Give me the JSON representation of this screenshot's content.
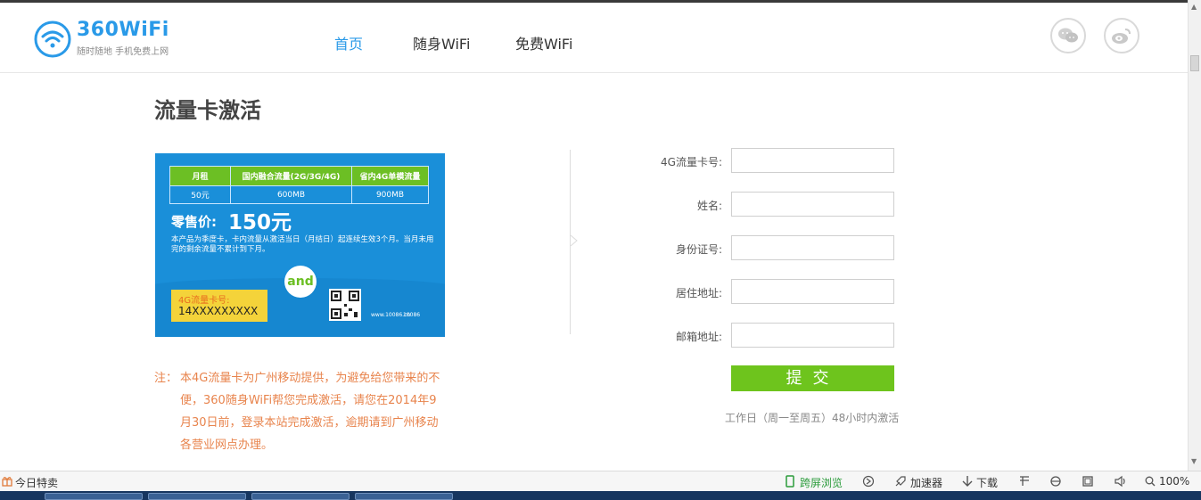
{
  "header": {
    "logo_title": "360WiFi",
    "logo_sub": "随时随地  手机免费上网",
    "nav": [
      {
        "label": "首页"
      },
      {
        "label": "随身WiFi"
      },
      {
        "label": "免费WiFi"
      }
    ]
  },
  "main": {
    "page_title": "流量卡激活",
    "card": {
      "table_headers": [
        "月租",
        "国内融合流量(2G/3G/4G)",
        "省内4G单模流量"
      ],
      "table_values": [
        "50元",
        "600MB",
        "900MB"
      ],
      "price_label": "零售价:",
      "price": "150元",
      "note": "本产品为季度卡，卡内流量从激活当日（月结日）起连续生效3个月。当月未用完的剩余流量不累计到下月。",
      "number_label": "4G流量卡号:",
      "number": "14XXXXXXXXX",
      "site1": "www.10086.cn",
      "site2": "10086"
    },
    "notice_head": "注：",
    "notice_body": "本4G流量卡为广州移动提供，为避免给您带来的不便，360随身WiFi帮您完成激活，请您在2014年9月30日前，登录本站完成激活，逾期请到广州移动各营业网点办理。"
  },
  "form": {
    "fields": [
      {
        "label": "4G流量卡号:",
        "value": ""
      },
      {
        "label": "姓名:",
        "value": ""
      },
      {
        "label": "身份证号:",
        "value": ""
      },
      {
        "label": "居住地址:",
        "value": ""
      },
      {
        "label": "邮箱地址:",
        "value": ""
      }
    ],
    "submit_label": "提交",
    "hint": "工作日（周一至周五）48小时内激活"
  },
  "statusbar": {
    "left": "今日特卖",
    "cross_screen": "跨屏浏览",
    "accelerator": "加速器",
    "download": "下载",
    "zoom": "100%"
  },
  "colors": {
    "accent": "#2a9ae8",
    "submit": "#6ec41d",
    "notice": "#e8844d",
    "card": "#1a8fd9"
  }
}
